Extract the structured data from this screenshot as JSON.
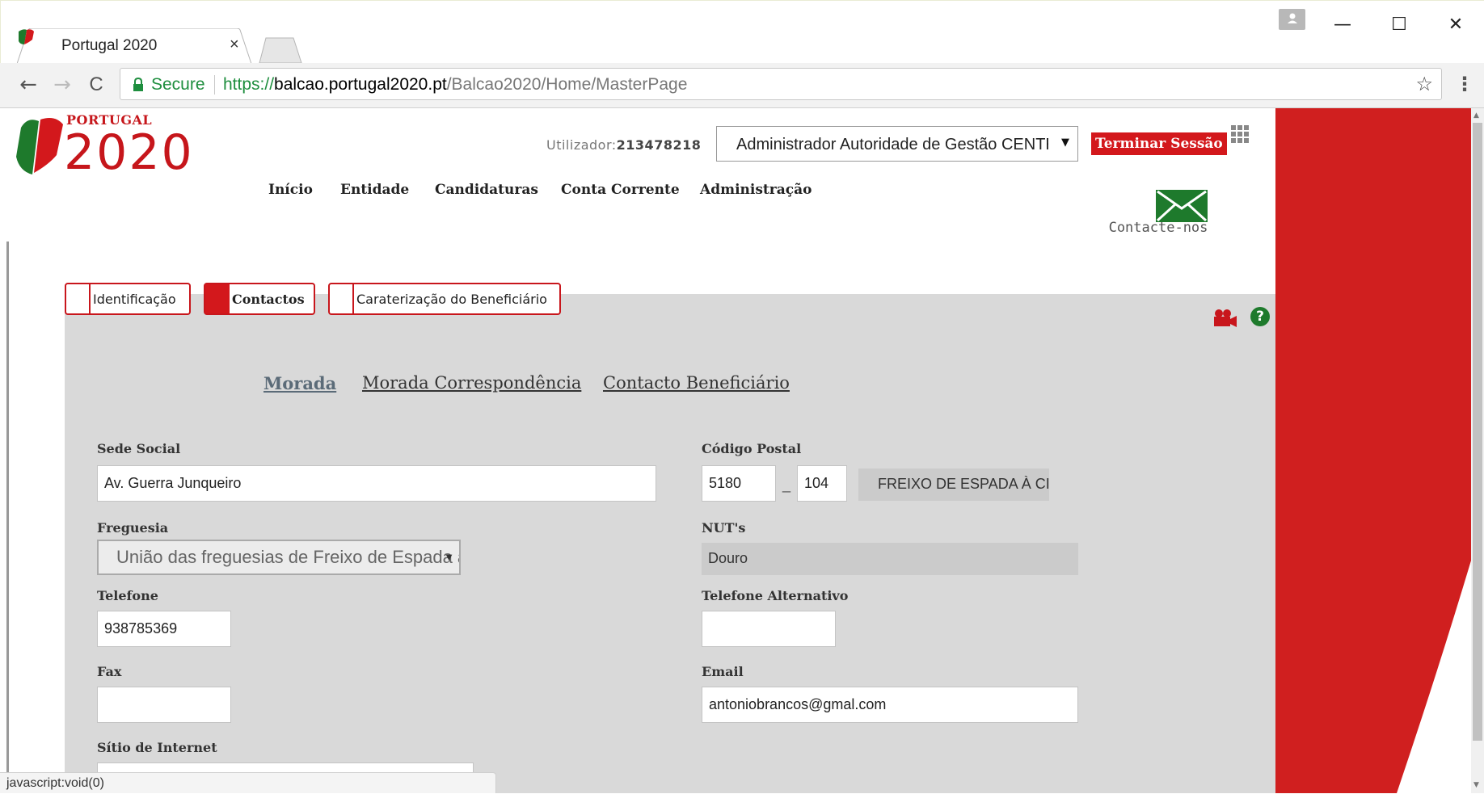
{
  "browser": {
    "tab_title": "Portugal 2020",
    "tab_close": "×",
    "security_label": "Secure",
    "url": {
      "scheme": "https://",
      "host": "balcao.portugal2020.pt",
      "path": "/Balcao2020/Home/MasterPage"
    },
    "back": "←",
    "forward": "→",
    "reload": "C",
    "star": "☆",
    "menu": "⋮",
    "win_minimize": "—",
    "win_maximize": "☐",
    "win_close": "✕",
    "status_text": "javascript:void(0)"
  },
  "header": {
    "logo_small": "PORTUGAL",
    "logo_big": "2020",
    "user_label": "Utilizador:",
    "user_id": "213478218",
    "role_selected": "Administrador Autoridade de Gestão CENTRO",
    "logout_label": "Terminar Sessão",
    "contact_label": "Contacte-nos"
  },
  "nav": {
    "items": [
      "Início",
      "Entidade",
      "Candidaturas",
      "Conta Corrente",
      "Administração"
    ]
  },
  "tabs": [
    {
      "label": "Identificação",
      "active": false
    },
    {
      "label": "Contactos",
      "active": true
    },
    {
      "label": "Caraterização do Beneficiário",
      "active": false
    }
  ],
  "subtabs": [
    {
      "label": "Morada",
      "active": true
    },
    {
      "label": "Morada Correspondência",
      "active": false
    },
    {
      "label": "Contacto Beneficiário",
      "active": false
    }
  ],
  "form": {
    "sede_social": {
      "label": "Sede Social",
      "value": "Av. Guerra Junqueiro"
    },
    "codigo_postal": {
      "label": "Código Postal",
      "part1": "5180",
      "separator": "_",
      "part2": "104",
      "localidade": "FREIXO DE ESPADA À CINTA"
    },
    "freguesia": {
      "label": "Freguesia",
      "value": "União das freguesias de Freixo de Espada à Cinta e Mazouco"
    },
    "nuts": {
      "label": "NUT's",
      "value": "Douro"
    },
    "telefone": {
      "label": "Telefone",
      "value": "938785369"
    },
    "telefone_alt": {
      "label": "Telefone Alternativo",
      "value": ""
    },
    "fax": {
      "label": "Fax",
      "value": ""
    },
    "email": {
      "label": "Email",
      "value": "antoniobrancos@gmal.com"
    },
    "sitio": {
      "label": "Sítio de Internet",
      "value": ""
    }
  },
  "colors": {
    "brand_red": "#d3181c",
    "brand_green": "#1e7a2c",
    "panel_grey": "#d9d9d9"
  },
  "icons": [
    "lock-icon",
    "star-icon",
    "apps-grid-icon",
    "envelope-icon",
    "video-camera-icon",
    "help-icon",
    "profile-icon"
  ]
}
